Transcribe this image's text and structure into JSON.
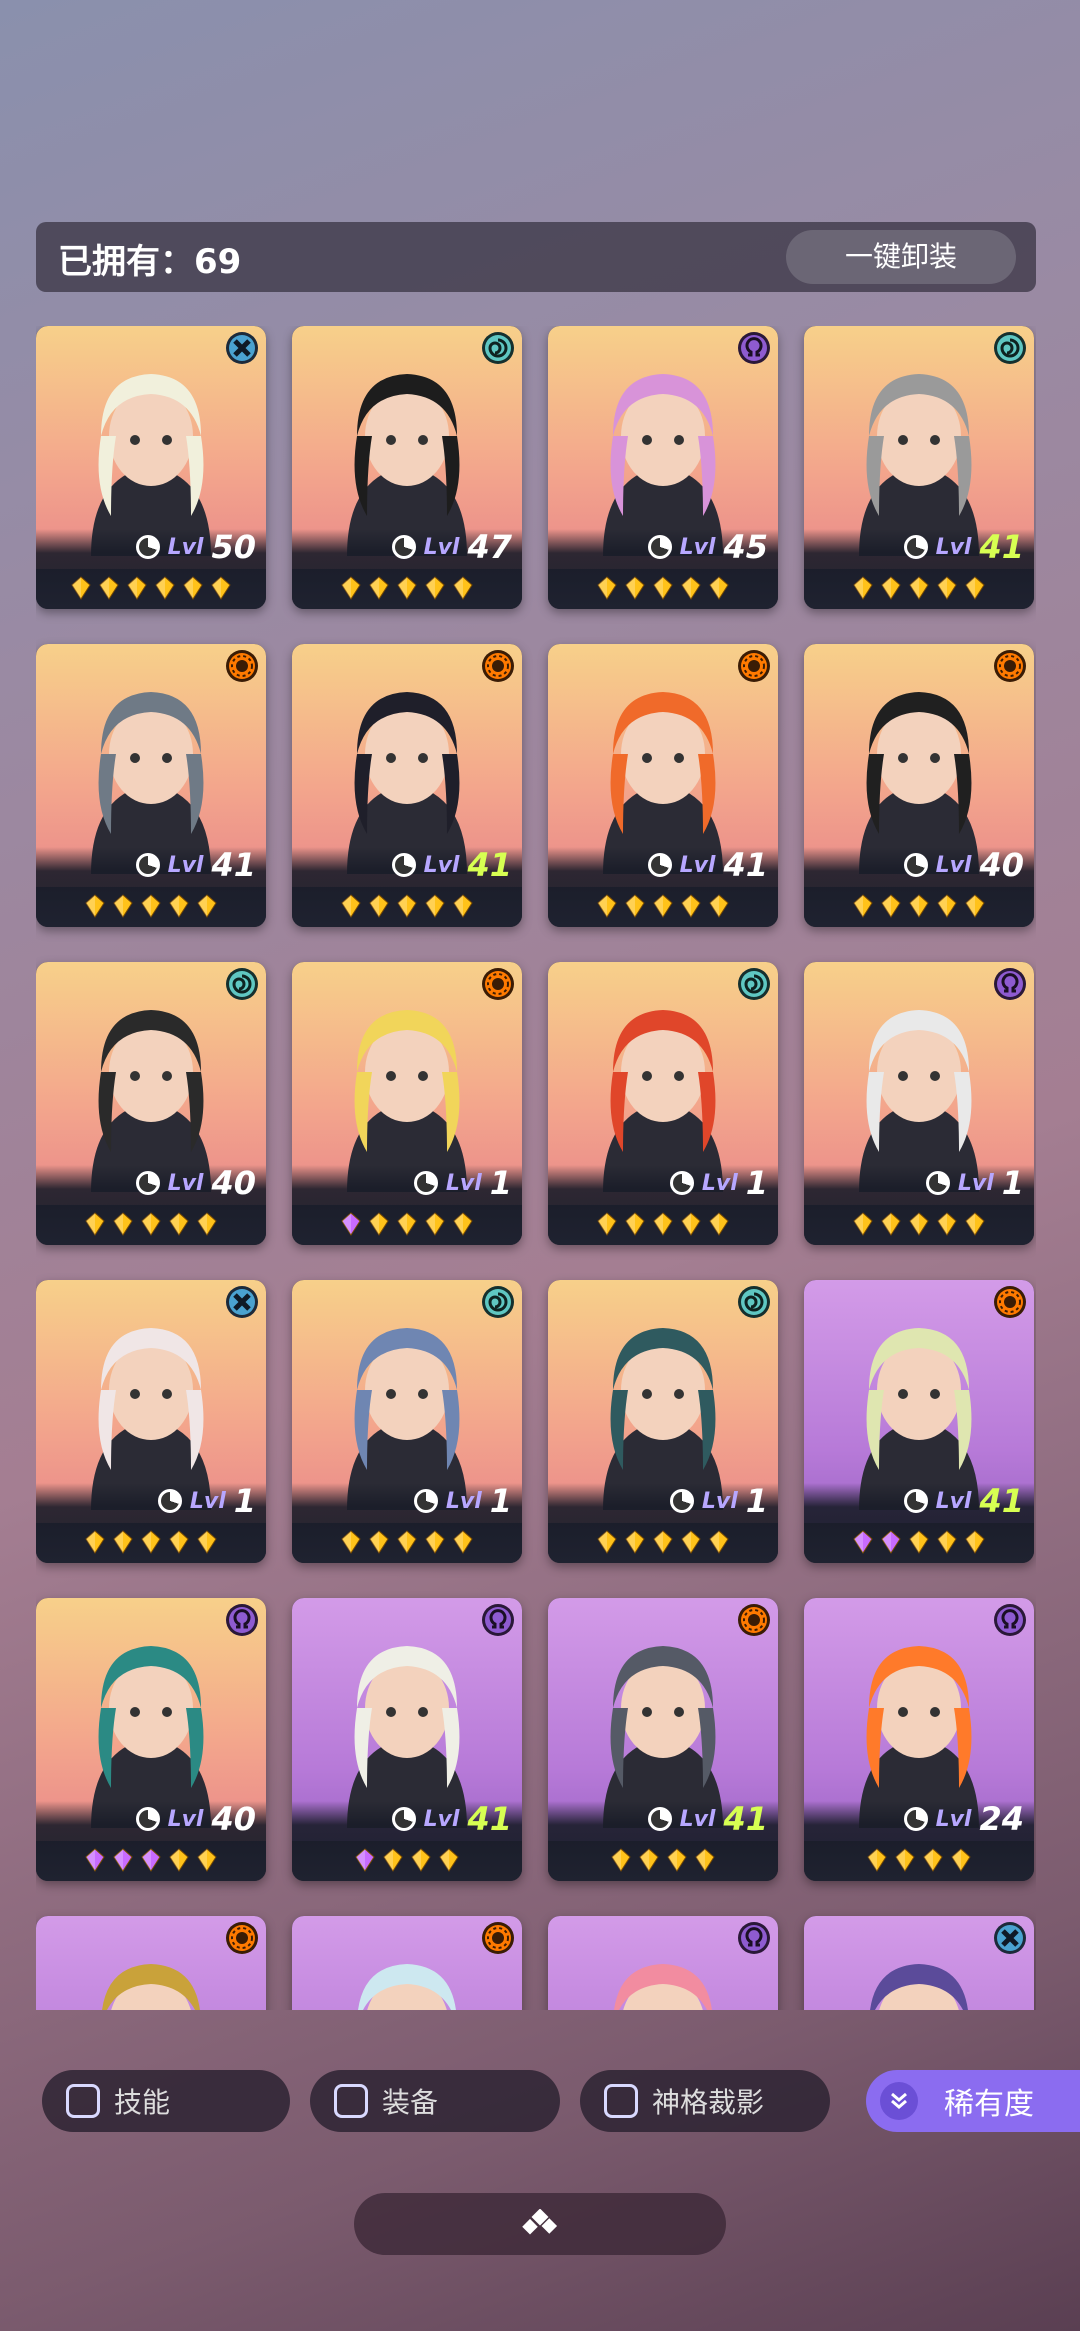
{
  "header": {
    "owned_label": "已拥有：69",
    "unequip_button": "一键卸装"
  },
  "colors": {
    "earth": "#5fc7c2",
    "fire": "#ff7a00",
    "arcane": "#8e5bd0",
    "void": "#4aa2d0",
    "level_green": "#d7ff52"
  },
  "level_prefix": "Lvl",
  "cards": [
    {
      "level": "50",
      "green": false,
      "stars": 6,
      "purple_stars": 0,
      "class_icon": "cross-icon",
      "bg": "warm",
      "hair": "#f1f0dc"
    },
    {
      "level": "47",
      "green": false,
      "stars": 5,
      "purple_stars": 0,
      "class_icon": "spiral-icon",
      "bg": "warm",
      "hair": "#1d1d1d"
    },
    {
      "level": "45",
      "green": false,
      "stars": 5,
      "purple_stars": 0,
      "class_icon": "omega-icon",
      "bg": "warm",
      "hair": "#d893d9"
    },
    {
      "level": "41",
      "green": true,
      "stars": 5,
      "purple_stars": 0,
      "class_icon": "spiral-icon",
      "bg": "warm",
      "hair": "#9a9a9a"
    },
    {
      "level": "41",
      "green": false,
      "stars": 5,
      "purple_stars": 0,
      "class_icon": "sun-icon",
      "bg": "warm",
      "hair": "#6f7a86"
    },
    {
      "level": "41",
      "green": true,
      "stars": 5,
      "purple_stars": 0,
      "class_icon": "sun-icon",
      "bg": "warm",
      "hair": "#1f1f2a"
    },
    {
      "level": "41",
      "green": false,
      "stars": 5,
      "purple_stars": 0,
      "class_icon": "sun-icon",
      "bg": "warm",
      "hair": "#f06a2a"
    },
    {
      "level": "40",
      "green": false,
      "stars": 5,
      "purple_stars": 0,
      "class_icon": "sun-icon",
      "bg": "warm",
      "hair": "#202020"
    },
    {
      "level": "40",
      "green": false,
      "stars": 5,
      "purple_stars": 0,
      "class_icon": "spiral-icon",
      "bg": "warm",
      "hair": "#2a2a2a"
    },
    {
      "level": "1",
      "green": false,
      "stars": 5,
      "purple_stars": 1,
      "class_icon": "sun-icon",
      "bg": "warm",
      "hair": "#f1d55a"
    },
    {
      "level": "1",
      "green": false,
      "stars": 5,
      "purple_stars": 0,
      "class_icon": "spiral-icon",
      "bg": "warm",
      "hair": "#e0462a"
    },
    {
      "level": "1",
      "green": false,
      "stars": 5,
      "purple_stars": 0,
      "class_icon": "omega-icon",
      "bg": "warm",
      "hair": "#e9e9e9"
    },
    {
      "level": "1",
      "green": false,
      "stars": 5,
      "purple_stars": 0,
      "class_icon": "cross-icon",
      "bg": "warm",
      "hair": "#f0e6e6"
    },
    {
      "level": "1",
      "green": false,
      "stars": 5,
      "purple_stars": 0,
      "class_icon": "spiral-icon",
      "bg": "warm",
      "hair": "#6f86b2"
    },
    {
      "level": "1",
      "green": false,
      "stars": 5,
      "purple_stars": 0,
      "class_icon": "spiral-icon",
      "bg": "warm",
      "hair": "#2f5a5f"
    },
    {
      "level": "41",
      "green": true,
      "stars": 5,
      "purple_stars": 2,
      "class_icon": "sun-icon",
      "bg": "purple",
      "hair": "#dfe6b0"
    },
    {
      "level": "40",
      "green": false,
      "stars": 5,
      "purple_stars": 3,
      "class_icon": "omega-icon",
      "bg": "warm",
      "hair": "#2b8a84"
    },
    {
      "level": "41",
      "green": true,
      "stars": 4,
      "purple_stars": 1,
      "class_icon": "omega-icon",
      "bg": "purple",
      "hair": "#efefe6"
    },
    {
      "level": "41",
      "green": true,
      "stars": 4,
      "purple_stars": 0,
      "class_icon": "sun-icon",
      "bg": "purple",
      "hair": "#555a66"
    },
    {
      "level": "24",
      "green": false,
      "stars": 4,
      "purple_stars": 0,
      "class_icon": "omega-icon",
      "bg": "purple",
      "hair": "#ff7a2a"
    },
    {
      "level": "",
      "green": false,
      "stars": 0,
      "purple_stars": 0,
      "class_icon": "sun-icon",
      "bg": "purple",
      "hair": "#c9a23a"
    },
    {
      "level": "",
      "green": false,
      "stars": 0,
      "purple_stars": 0,
      "class_icon": "sun-icon",
      "bg": "purple",
      "hair": "#cde8f0"
    },
    {
      "level": "",
      "green": false,
      "stars": 0,
      "purple_stars": 0,
      "class_icon": "omega-icon",
      "bg": "purple",
      "hair": "#f28ca0"
    },
    {
      "level": "",
      "green": false,
      "stars": 0,
      "purple_stars": 0,
      "class_icon": "cross-icon",
      "bg": "purple",
      "hair": "#5b4b9a"
    }
  ],
  "filters": {
    "skills": "技能",
    "equipment": "装备",
    "divine_shadow": "神格裁影",
    "rarity": "稀有度"
  }
}
